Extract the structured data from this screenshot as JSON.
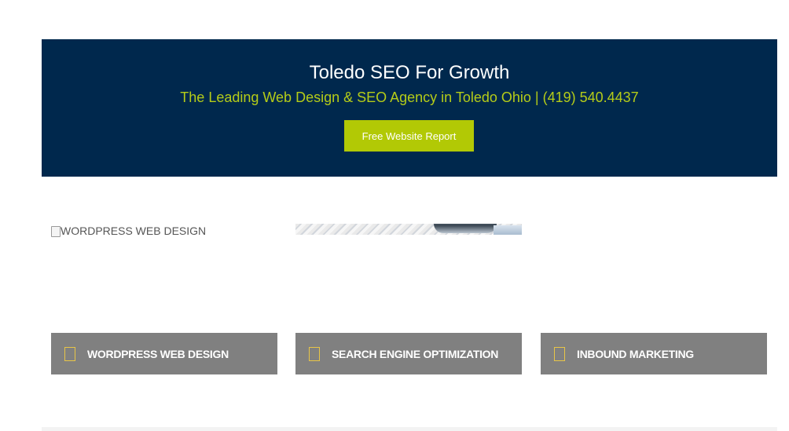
{
  "hero": {
    "title": "Toledo SEO For Growth",
    "subtitle": "The Leading Web Design & SEO Agency in Toledo Ohio | (419) 540.4437",
    "cta_label": "Free Website Report",
    "bg_color": "#00284d",
    "accent_color": "#b5cc18"
  },
  "images": {
    "broken_alt": "WORDPRESS WEB DESIGN"
  },
  "services": [
    {
      "label": "WORDPRESS WEB DESIGN",
      "icon": "square-outline-icon"
    },
    {
      "label": "SEARCH ENGINE OPTIMIZATION",
      "icon": "square-outline-icon"
    },
    {
      "label": "INBOUND MARKETING",
      "icon": "square-outline-icon"
    }
  ],
  "colors": {
    "card_bg": "#808080",
    "icon_outline": "#e8c547"
  }
}
